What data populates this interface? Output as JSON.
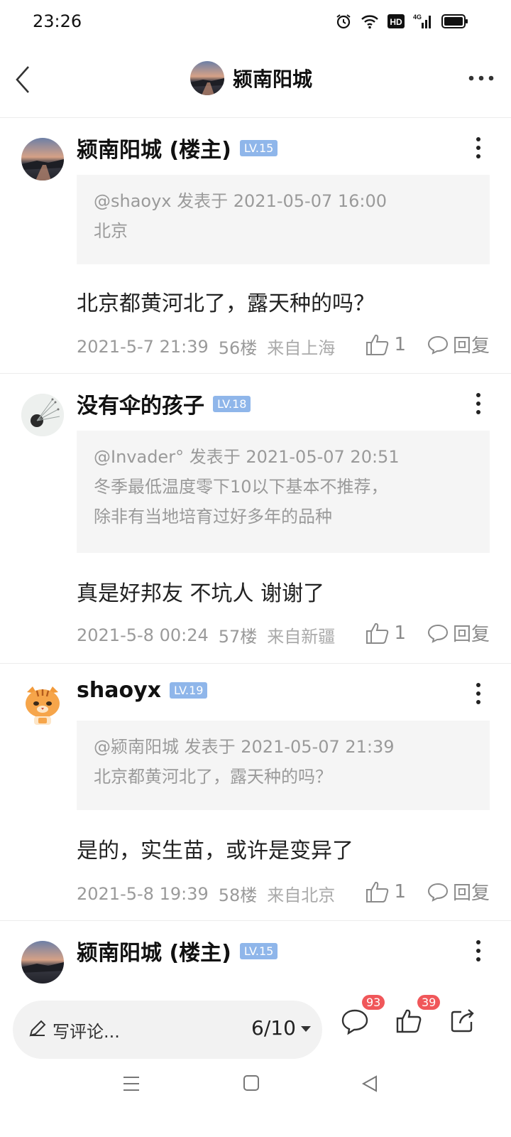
{
  "status": {
    "time": "23:26",
    "hd": "HD",
    "network": "4G"
  },
  "header": {
    "title": "颍南阳城"
  },
  "posts": [
    {
      "user": "颍南阳城 (楼主)",
      "level": "LV.15",
      "quote_head": "@shaoyx 发表于 2021-05-07 16:00",
      "quote_body": [
        "北京"
      ],
      "text": "北京都黄河北了，露天种的吗？",
      "time": "2021-5-7 21:39",
      "floor": "56楼",
      "origin": "来自上海",
      "likes": "1",
      "reply_label": "回复"
    },
    {
      "user": "没有伞的孩子",
      "level": "LV.18",
      "quote_head": "@Invader° 发表于 2021-05-07 20:51",
      "quote_body": [
        "冬季最低温度零下10以下基本不推荐，",
        "除非有当地培育过好多年的品种"
      ],
      "text": "真是好邦友 不坑人 谢谢了",
      "time": "2021-5-8 00:24",
      "floor": "57楼",
      "origin": "来自新疆",
      "likes": "1",
      "reply_label": "回复"
    },
    {
      "user": "shaoyx",
      "level": "LV.19",
      "quote_head": "@颍南阳城 发表于 2021-05-07 21:39",
      "quote_body": [
        "北京都黄河北了，露天种的吗？"
      ],
      "text": "是的，实生苗，或许是变异了",
      "time": "2021-5-8 19:39",
      "floor": "58楼",
      "origin": "来自北京",
      "likes": "1",
      "reply_label": "回复"
    },
    {
      "user": "颍南阳城 (楼主)",
      "level": "LV.15"
    }
  ],
  "bottom": {
    "comment_placeholder": "写评论...",
    "page_indicator": "6/10",
    "comment_count": "93",
    "like_count": "39"
  },
  "colors": {
    "badge_blue": "#8fb6ea",
    "count_red": "#f0575a",
    "quote_bg": "#f5f5f5"
  }
}
